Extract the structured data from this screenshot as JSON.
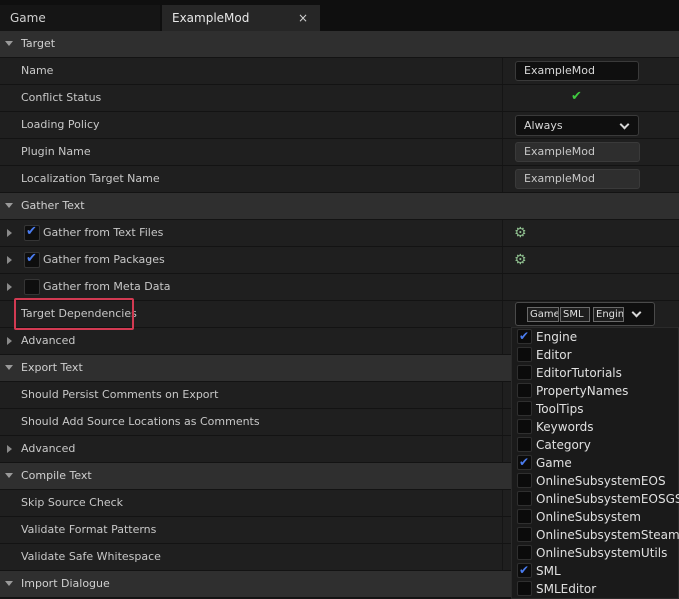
{
  "tabs": {
    "game": "Game",
    "active": "ExampleMod",
    "close": "×"
  },
  "rows": [
    {
      "kind": "cat",
      "label": "Target"
    },
    {
      "kind": "prop",
      "label": "Name",
      "value": "ExampleMod",
      "widget": "text"
    },
    {
      "kind": "prop",
      "label": "Conflict Status",
      "widget": "check",
      "value": "✔"
    },
    {
      "kind": "prop",
      "label": "Loading Policy",
      "widget": "combo",
      "value": "Always"
    },
    {
      "kind": "prop",
      "label": "Plugin Name",
      "widget": "readonly",
      "value": "ExampleMod"
    },
    {
      "kind": "prop",
      "label": "Localization Target Name",
      "widget": "readonly",
      "value": "ExampleMod"
    },
    {
      "kind": "cat",
      "label": "Gather Text"
    },
    {
      "kind": "prop",
      "label": "Gather from Text Files",
      "checked": true,
      "expandable": true,
      "widget": "gear"
    },
    {
      "kind": "prop",
      "label": "Gather from Packages",
      "checked": true,
      "expandable": true,
      "widget": "gear"
    },
    {
      "kind": "prop",
      "label": "Gather from Meta Data",
      "checked": false,
      "expandable": true
    },
    {
      "kind": "prop",
      "label": "Target Dependencies"
    },
    {
      "kind": "prop",
      "label": "Advanced",
      "expandable": true
    },
    {
      "kind": "cat",
      "label": "Export Text"
    },
    {
      "kind": "prop",
      "label": "Should Persist Comments on Export"
    },
    {
      "kind": "prop",
      "label": "Should Add Source Locations as Comments"
    },
    {
      "kind": "prop",
      "label": "Advanced",
      "expandable": true
    },
    {
      "kind": "cat",
      "label": "Compile Text"
    },
    {
      "kind": "prop",
      "label": "Skip Source Check"
    },
    {
      "kind": "prop",
      "label": "Validate Format Patterns"
    },
    {
      "kind": "prop",
      "label": "Validate Safe Whitespace"
    },
    {
      "kind": "cat",
      "label": "Import Dialogue"
    }
  ],
  "dependencies": {
    "chips": [
      "Game",
      "SML",
      "Engine"
    ],
    "options": [
      {
        "label": "Engine",
        "checked": true
      },
      {
        "label": "Editor",
        "checked": false
      },
      {
        "label": "EditorTutorials",
        "checked": false
      },
      {
        "label": "PropertyNames",
        "checked": false
      },
      {
        "label": "ToolTips",
        "checked": false
      },
      {
        "label": "Keywords",
        "checked": false
      },
      {
        "label": "Category",
        "checked": false
      },
      {
        "label": "Game",
        "checked": true
      },
      {
        "label": "OnlineSubsystemEOS",
        "checked": false
      },
      {
        "label": "OnlineSubsystemEOSGS",
        "checked": false
      },
      {
        "label": "OnlineSubsystem",
        "checked": false
      },
      {
        "label": "OnlineSubsystemSteam",
        "checked": false
      },
      {
        "label": "OnlineSubsystemUtils",
        "checked": false
      },
      {
        "label": "SML",
        "checked": true
      },
      {
        "label": "SMLEditor",
        "checked": false
      }
    ]
  },
  "icons": {
    "checkbox": "checkmark-icon",
    "gear": "gear-icon",
    "expand": "chevron-right-icon",
    "collapse": "chevron-down-icon"
  },
  "colors": {
    "highlight": "#d23a52",
    "check": "#4a7cf0",
    "ok": "#3fc93f"
  }
}
